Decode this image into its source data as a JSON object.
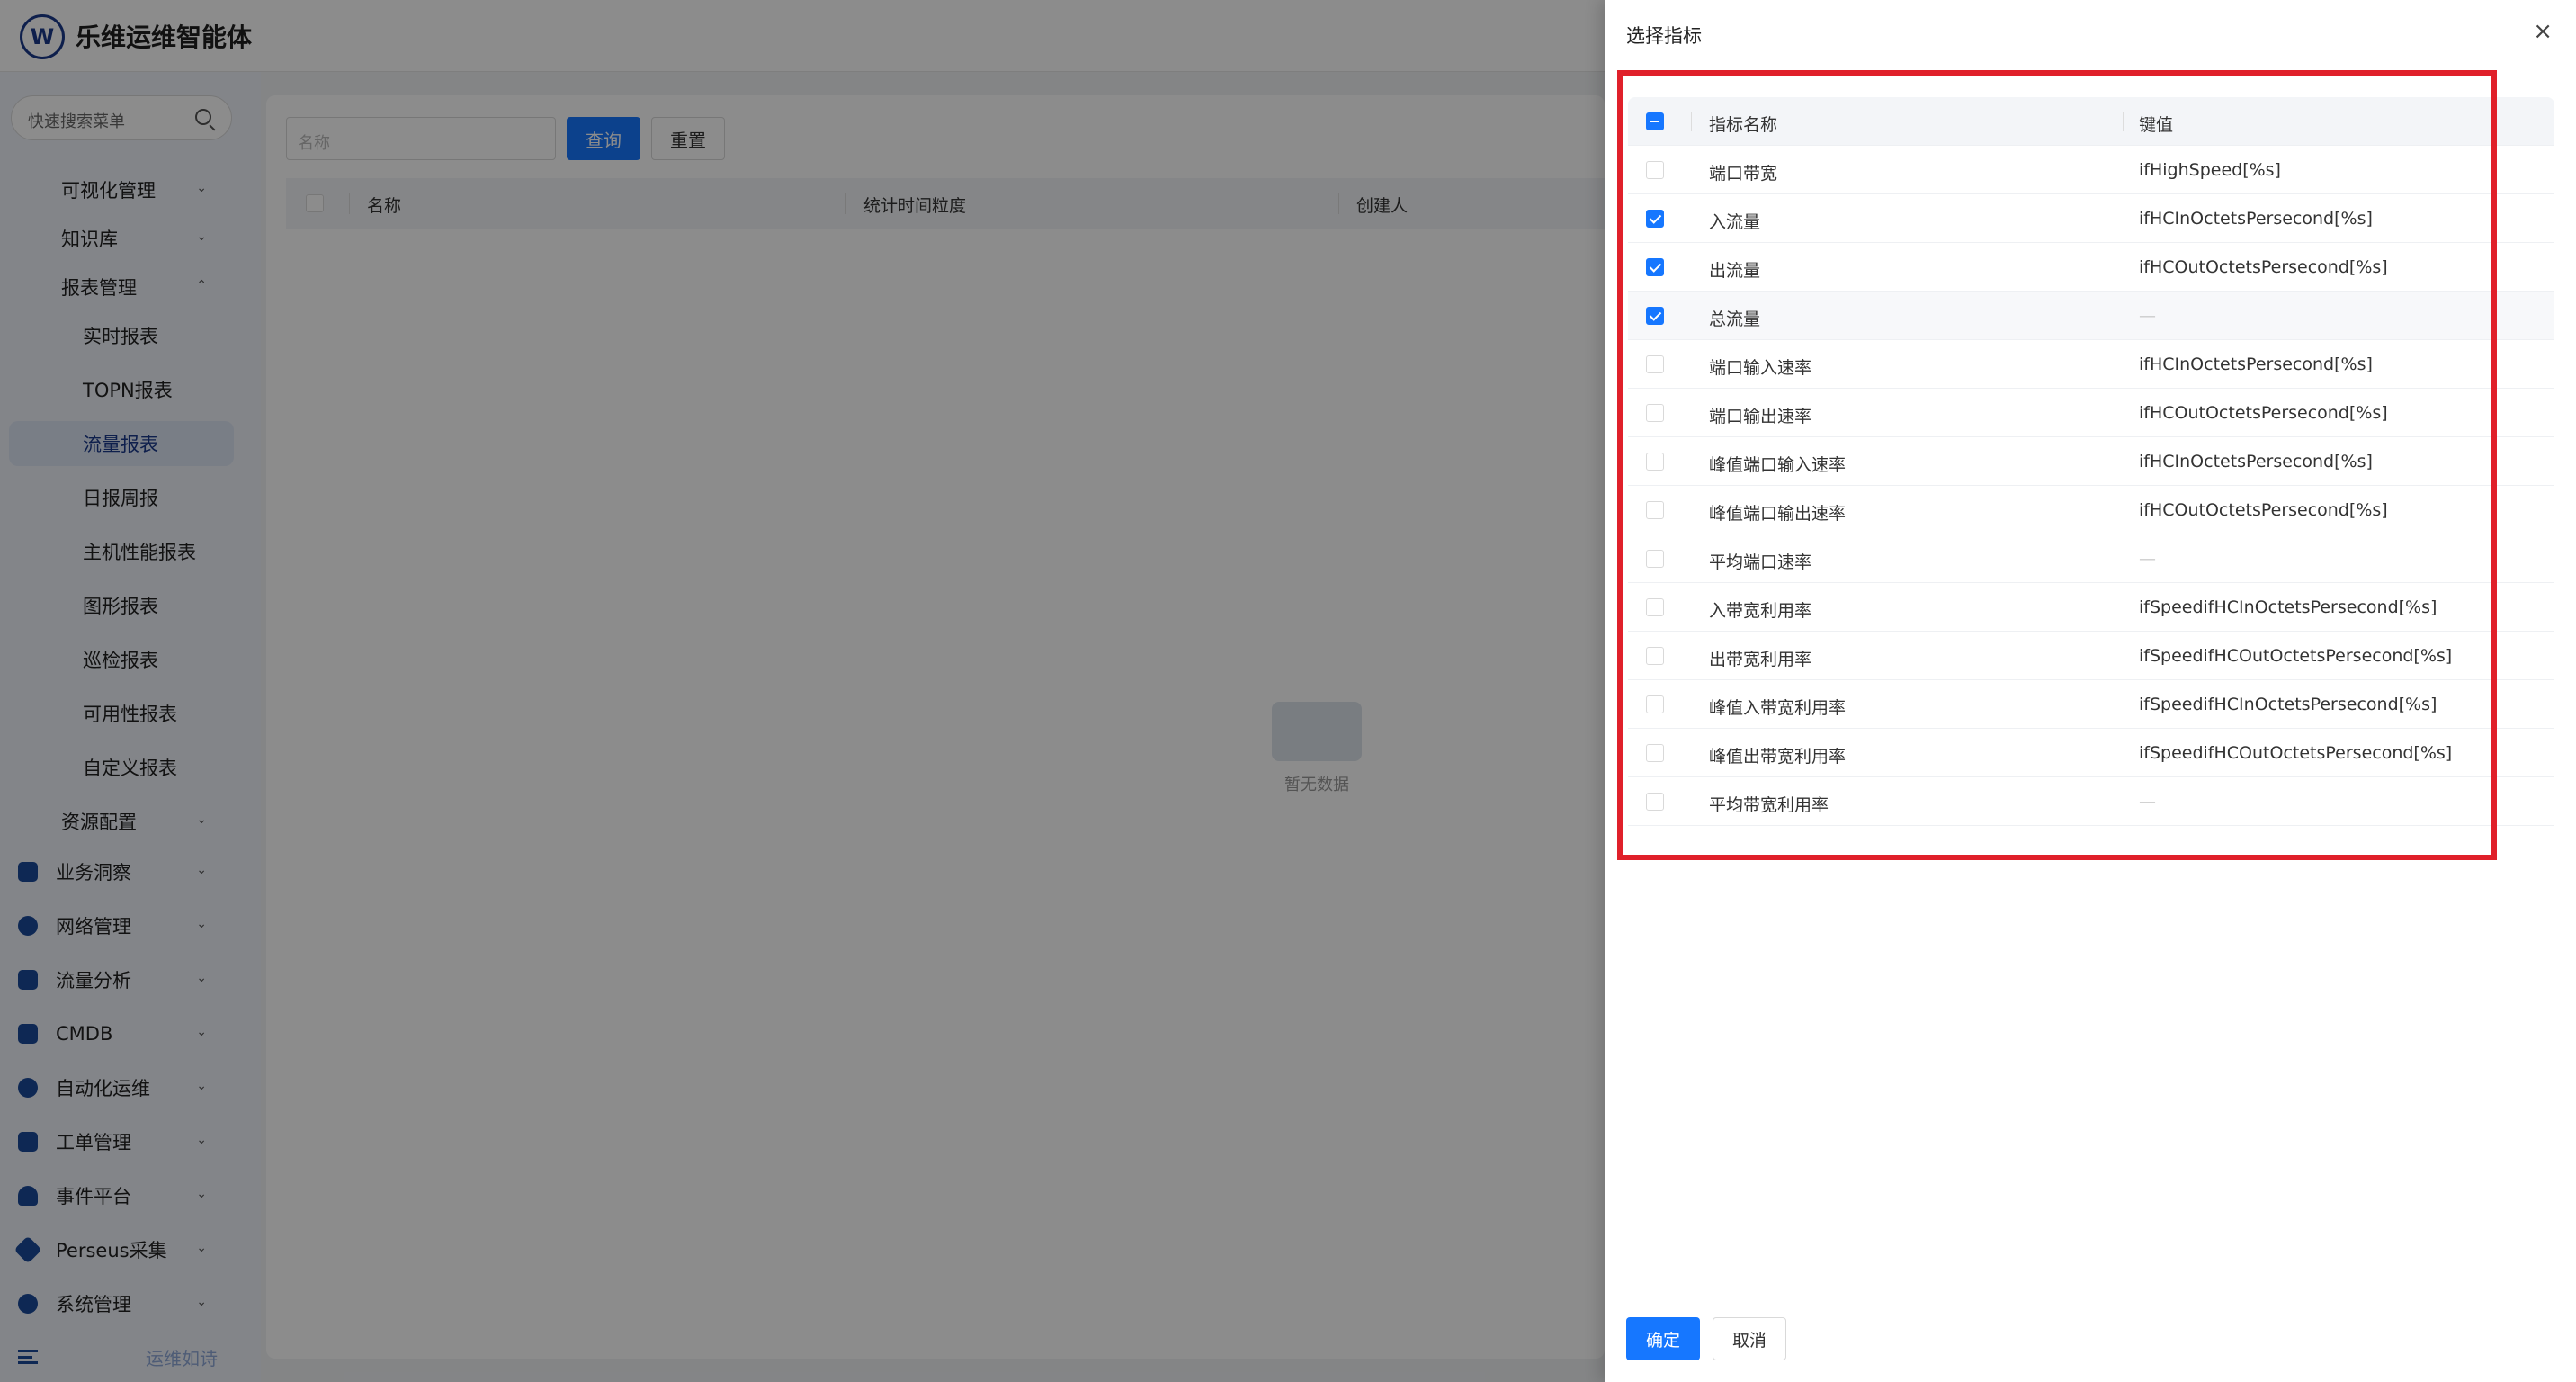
{
  "app": {
    "brand": "乐维运维智能体"
  },
  "sidebar": {
    "search_placeholder": "快速搜索菜单",
    "items": [
      {
        "label": "可视化管理"
      },
      {
        "label": "知识库"
      },
      {
        "label": "报表管理"
      },
      {
        "label": "实时报表"
      },
      {
        "label": "TOPN报表"
      },
      {
        "label": "流量报表"
      },
      {
        "label": "日报周报"
      },
      {
        "label": "主机性能报表"
      },
      {
        "label": "图形报表"
      },
      {
        "label": "巡检报表"
      },
      {
        "label": "可用性报表"
      },
      {
        "label": "自定义报表"
      },
      {
        "label": "资源配置"
      },
      {
        "label": "业务洞察"
      },
      {
        "label": "网络管理"
      },
      {
        "label": "流量分析"
      },
      {
        "label": "CMDB"
      },
      {
        "label": "自动化运维"
      },
      {
        "label": "工单管理"
      },
      {
        "label": "事件平台"
      },
      {
        "label": "Perseus采集"
      },
      {
        "label": "系统管理"
      }
    ],
    "footer": "运维如诗"
  },
  "main": {
    "name_placeholder": "名称",
    "query_label": "查询",
    "reset_label": "重置",
    "columns": [
      "名称",
      "统计时间粒度",
      "创建人"
    ],
    "empty_text": "暂无数据"
  },
  "drawer": {
    "title": "选择指标",
    "close": "×",
    "headers": {
      "name": "指标名称",
      "key": "键值"
    },
    "rows": [
      {
        "name": "端口带宽",
        "key": "ifHighSpeed[%s]",
        "checked": false
      },
      {
        "name": "入流量",
        "key": "ifHCInOctetsPersecond[%s]",
        "checked": true
      },
      {
        "name": "出流量",
        "key": "ifHCOutOctetsPersecond[%s]",
        "checked": true
      },
      {
        "name": "总流量",
        "key": "—",
        "checked": true
      },
      {
        "name": "端口输入速率",
        "key": "ifHCInOctetsPersecond[%s]",
        "checked": false
      },
      {
        "name": "端口输出速率",
        "key": "ifHCOutOctetsPersecond[%s]",
        "checked": false
      },
      {
        "name": "峰值端口输入速率",
        "key": "ifHCInOctetsPersecond[%s]",
        "checked": false
      },
      {
        "name": "峰值端口输出速率",
        "key": "ifHCOutOctetsPersecond[%s]",
        "checked": false
      },
      {
        "name": "平均端口速率",
        "key": "—",
        "checked": false
      },
      {
        "name": "入带宽利用率",
        "key": "ifSpeedifHCInOctetsPersecond[%s]",
        "checked": false
      },
      {
        "name": "出带宽利用率",
        "key": "ifSpeedifHCOutOctetsPersecond[%s]",
        "checked": false
      },
      {
        "name": "峰值入带宽利用率",
        "key": "ifSpeedifHCInOctetsPersecond[%s]",
        "checked": false
      },
      {
        "name": "峰值出带宽利用率",
        "key": "ifSpeedifHCOutOctetsPersecond[%s]",
        "checked": false
      },
      {
        "name": "平均带宽利用率",
        "key": "—",
        "checked": false
      }
    ],
    "ok_label": "确定",
    "cancel_label": "取消"
  },
  "colors": {
    "primary": "#1677ff",
    "highlight": "#e0202a"
  }
}
